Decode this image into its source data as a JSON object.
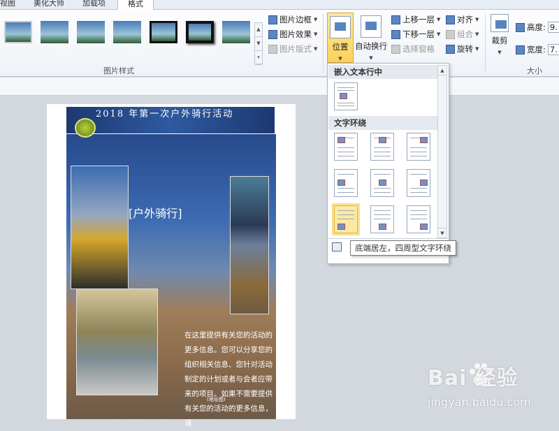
{
  "ribbon_tabs": [
    "视图",
    "美化大师",
    "加载项",
    "格式"
  ],
  "picture_styles": {
    "group_label": "图片样式",
    "commands": [
      {
        "label": "图片边框",
        "icon": "picture-border-icon",
        "enabled": true
      },
      {
        "label": "图片效果",
        "icon": "picture-effects-icon",
        "enabled": true
      },
      {
        "label": "图片版式",
        "icon": "picture-layout-icon",
        "enabled": false
      }
    ]
  },
  "arrange": {
    "position_label": "位置",
    "wrap_text_label": "自动换行",
    "commands": [
      {
        "label": "上移一层",
        "icon": "bring-forward-icon",
        "enabled": true
      },
      {
        "label": "下移一层",
        "icon": "send-backward-icon",
        "enabled": true
      },
      {
        "label": "选择窗格",
        "icon": "selection-pane-icon",
        "enabled": false
      },
      {
        "label": "对齐",
        "icon": "align-icon",
        "enabled": true
      },
      {
        "label": "组合",
        "icon": "group-icon",
        "enabled": false
      },
      {
        "label": "旋转",
        "icon": "rotate-icon",
        "enabled": true
      }
    ]
  },
  "size": {
    "crop_label": "裁剪",
    "height_label": "高度:",
    "height_value": "9.",
    "width_label": "宽度:",
    "width_value": "7.",
    "group_label": "大小"
  },
  "position_menu": {
    "inline_header": "嵌入文本行中",
    "wrap_header": "文字环绕",
    "tooltip": "底端居左，四周型文字环绕"
  },
  "document": {
    "banner_title": "2018 年第一次户外骑行活动",
    "caption": "[户外骑行]",
    "body_text": "在这里提供有关您的活动的更多信息。您可以分享您的组织相关信息、您针对活动制定的计划或者与会者应带来的项目。如果不需要提供有关您的活动的更多信息，请",
    "small_text": "(地址图)"
  },
  "watermark": {
    "brand": "Bai 经验",
    "url": "jingyan.baidu.com"
  }
}
